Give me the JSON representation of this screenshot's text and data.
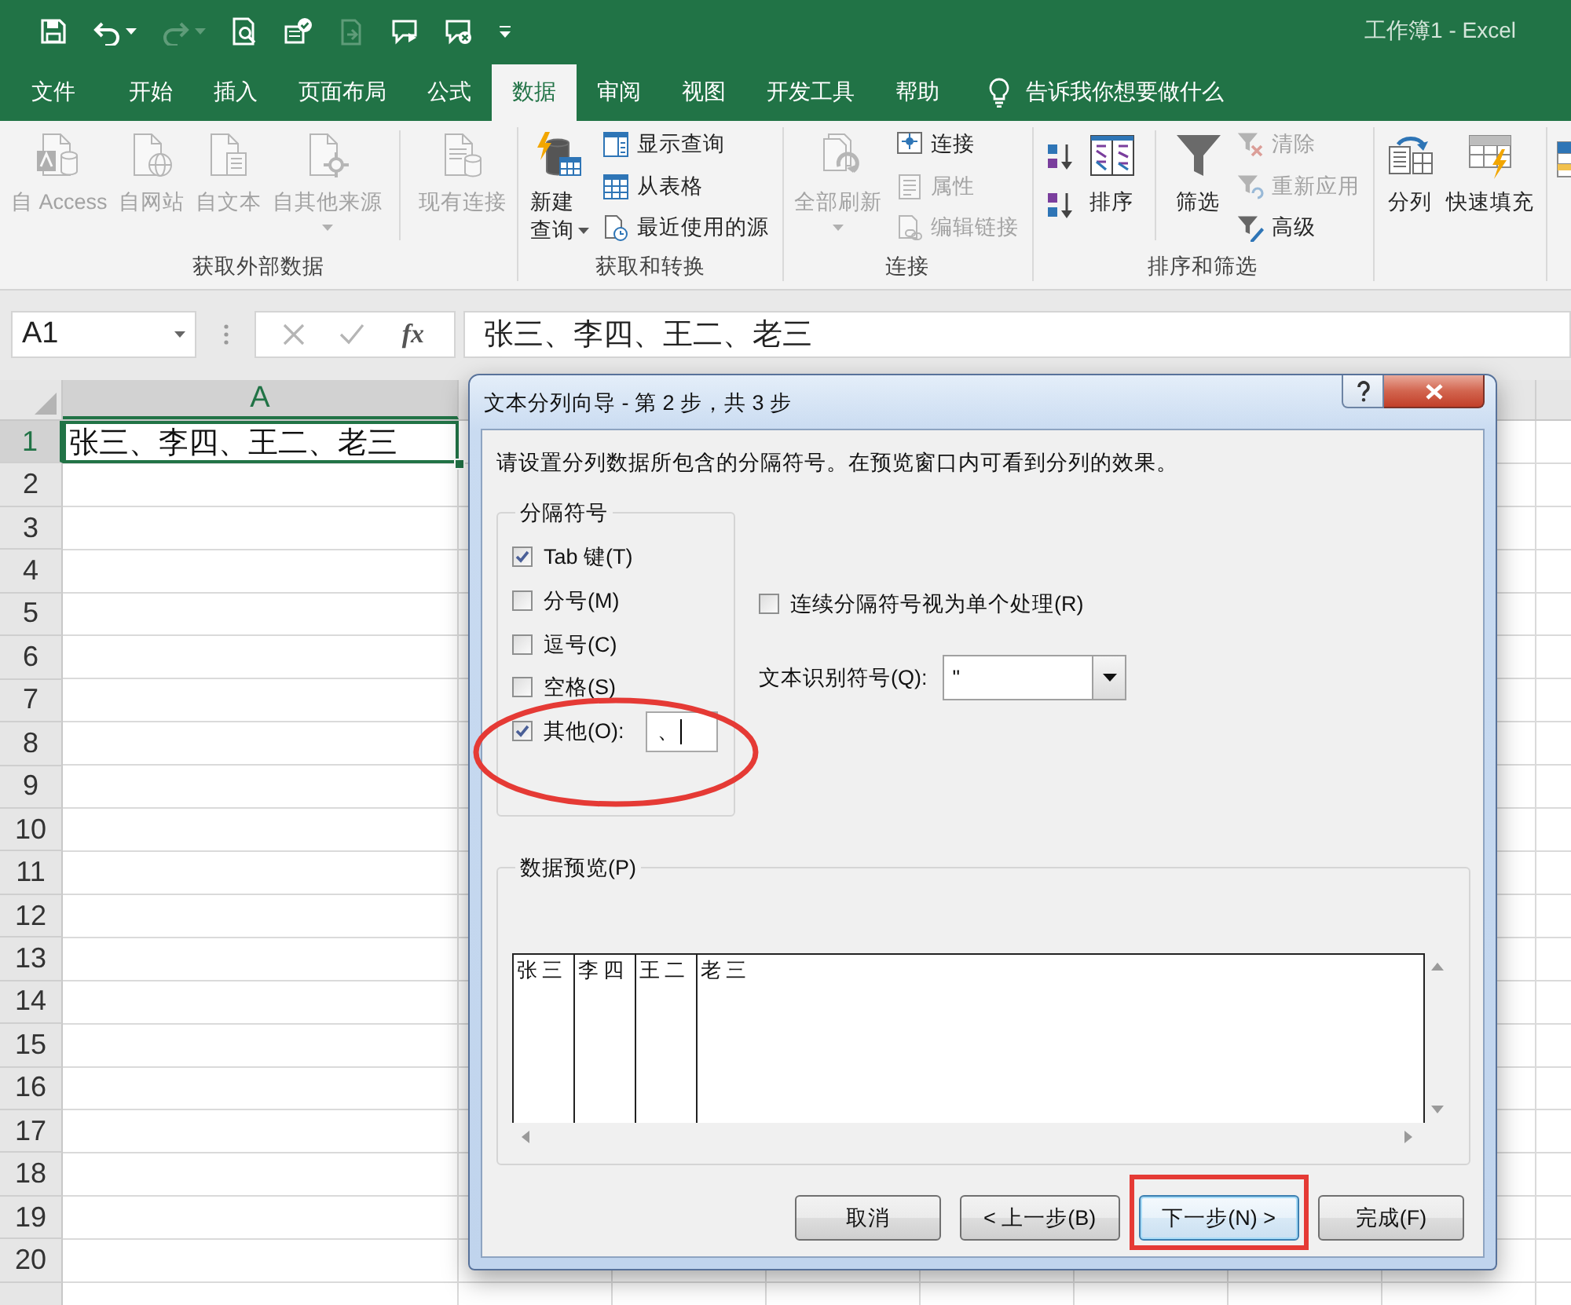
{
  "title": "工作簿1 - Excel",
  "tabs": [
    {
      "label": "文件",
      "selected": false
    },
    {
      "label": "开始",
      "selected": false
    },
    {
      "label": "插入",
      "selected": false
    },
    {
      "label": "页面布局",
      "selected": false
    },
    {
      "label": "公式",
      "selected": false
    },
    {
      "label": "数据",
      "selected": true
    },
    {
      "label": "审阅",
      "selected": false
    },
    {
      "label": "视图",
      "selected": false
    },
    {
      "label": "开发工具",
      "selected": false
    },
    {
      "label": "帮助",
      "selected": false
    }
  ],
  "tell_me": {
    "label": "告诉我你想要做什么"
  },
  "ribbon": {
    "groups": [
      {
        "label": "获取外部数据",
        "buttons": [
          {
            "kind": "large",
            "label": "自 Access",
            "disabled": true,
            "menu": false
          },
          {
            "kind": "large",
            "label": "自网站",
            "disabled": true,
            "menu": false
          },
          {
            "kind": "large",
            "label": "自文本",
            "disabled": true,
            "menu": false
          },
          {
            "kind": "large",
            "label": "自其他来源",
            "disabled": true,
            "menu": true
          },
          {
            "kind": "divider"
          },
          {
            "kind": "large",
            "label": "现有连接",
            "disabled": true,
            "menu": false
          }
        ]
      },
      {
        "label": "获取和转换",
        "buttons": [
          {
            "kind": "tall",
            "label": "新建查询",
            "disabled": false,
            "menu": true
          },
          {
            "kind": "small",
            "label": "显示查询",
            "disabled": false
          },
          {
            "kind": "small",
            "label": "从表格",
            "disabled": false
          },
          {
            "kind": "small",
            "label": "最近使用的源",
            "disabled": false
          }
        ]
      },
      {
        "label": "连接",
        "buttons": [
          {
            "kind": "large",
            "label": "全部刷新",
            "disabled": true,
            "menu": true
          },
          {
            "kind": "small",
            "label": "连接",
            "disabled": false
          },
          {
            "kind": "small",
            "label": "属性",
            "disabled": true
          },
          {
            "kind": "small",
            "label": "编辑链接",
            "disabled": true
          }
        ]
      },
      {
        "label": "排序和筛选",
        "buttons": [
          {
            "kind": "icon",
            "disabled": false
          },
          {
            "kind": "icon",
            "disabled": false
          },
          {
            "kind": "large",
            "label": "排序",
            "disabled": false,
            "menu": false
          },
          {
            "kind": "divider"
          },
          {
            "kind": "large",
            "label": "筛选",
            "disabled": false,
            "menu": false
          },
          {
            "kind": "small",
            "label": "清除",
            "disabled": true
          },
          {
            "kind": "small",
            "label": "重新应用",
            "disabled": true
          },
          {
            "kind": "small",
            "label": "高级",
            "disabled": false
          }
        ]
      },
      {
        "buttons": [
          {
            "kind": "large",
            "label": "分列",
            "disabled": false,
            "menu": false
          },
          {
            "kind": "large",
            "label": "快速填充",
            "disabled": false,
            "menu": false
          }
        ]
      }
    ]
  },
  "formula_bar": {
    "name_box": "A1",
    "function_label": "fx",
    "formula": "张三、李四、王二、老三"
  },
  "sheet": {
    "columns": [
      {
        "label": "A",
        "selected": true
      }
    ],
    "rows": [
      {
        "label": "1",
        "selected": true,
        "cells": [
          "张三、李四、王二、老三"
        ]
      },
      {
        "label": "2",
        "selected": false
      },
      {
        "label": "3",
        "selected": false
      },
      {
        "label": "4",
        "selected": false
      },
      {
        "label": "5",
        "selected": false
      },
      {
        "label": "6",
        "selected": false
      },
      {
        "label": "7",
        "selected": false
      },
      {
        "label": "8",
        "selected": false
      },
      {
        "label": "9",
        "selected": false
      },
      {
        "label": "10",
        "selected": false
      },
      {
        "label": "11",
        "selected": false
      },
      {
        "label": "12",
        "selected": false
      },
      {
        "label": "13",
        "selected": false
      },
      {
        "label": "14",
        "selected": false
      },
      {
        "label": "15",
        "selected": false
      },
      {
        "label": "16",
        "selected": false
      },
      {
        "label": "17",
        "selected": false
      },
      {
        "label": "18",
        "selected": false
      },
      {
        "label": "19",
        "selected": false
      },
      {
        "label": "20",
        "selected": false
      }
    ]
  },
  "dialog": {
    "title": "文本分列向导 - 第 2 步，共 3 步",
    "instruction": "请设置分列数据所包含的分隔符号。在预览窗口内可看到分列的效果。",
    "delimiters": {
      "label": "分隔符号",
      "options": [
        {
          "kind": "checkbox",
          "label": "Tab 键(T)",
          "checked": true,
          "highlighted": false
        },
        {
          "kind": "checkbox",
          "label": "分号(M)",
          "checked": false,
          "highlighted": false
        },
        {
          "kind": "checkbox",
          "label": "逗号(C)",
          "checked": false,
          "highlighted": false
        },
        {
          "kind": "checkbox",
          "label": "空格(S)",
          "checked": false,
          "highlighted": false
        },
        {
          "kind": "other",
          "label": "其他(O):",
          "checked": true,
          "value": "、",
          "highlighted": true
        }
      ]
    },
    "consecutive": {
      "label": "连续分隔符号视为单个处理(R)",
      "checked": false
    },
    "text_qualifier": {
      "label": "文本识别符号(Q):",
      "value": "\""
    },
    "preview": {
      "label": "数据预览(P)",
      "columns": [
        "张三",
        "李四",
        "王二",
        "老三"
      ]
    },
    "buttons": [
      {
        "label": "取消",
        "focused": false,
        "highlighted": false
      },
      {
        "label": "< 上一步(B)",
        "focused": false,
        "highlighted": false
      },
      {
        "label": "下一步(N) >",
        "focused": true,
        "highlighted": true
      },
      {
        "label": "完成(F)",
        "focused": false,
        "highlighted": false
      }
    ]
  }
}
